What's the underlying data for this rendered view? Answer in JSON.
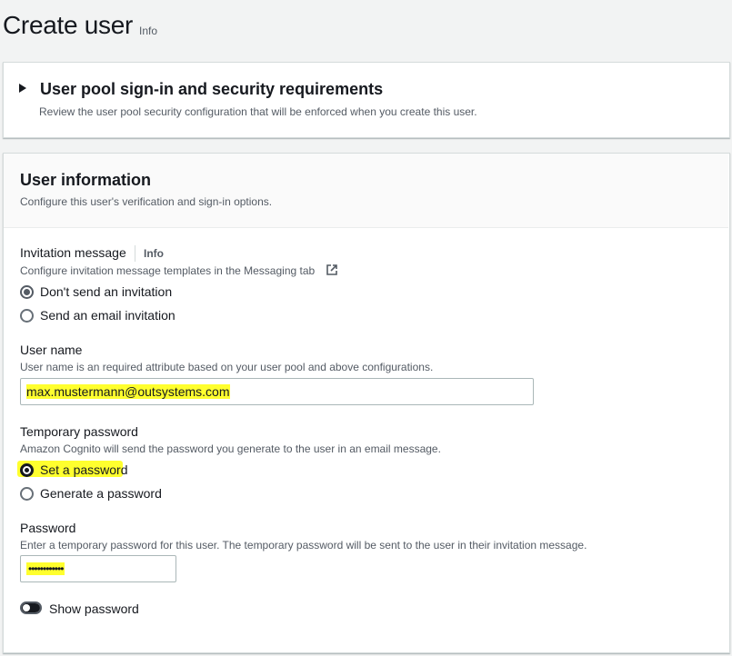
{
  "header": {
    "title": "Create user",
    "info": "Info"
  },
  "security_panel": {
    "title": "User pool sign-in and security requirements",
    "description": "Review the user pool security configuration that will be enforced when you create this user."
  },
  "user_info": {
    "title": "User information",
    "description": "Configure this user's verification and sign-in options.",
    "invitation": {
      "label": "Invitation message",
      "info": "Info",
      "description": "Configure invitation message templates in the Messaging tab",
      "options": [
        {
          "label": "Don't send an invitation",
          "selected": true
        },
        {
          "label": "Send an email invitation",
          "selected": false
        }
      ]
    },
    "username": {
      "label": "User name",
      "description": "User name is an required attribute based on your user pool and above configurations.",
      "value": "max.mustermann@outsystems.com"
    },
    "temp_password": {
      "label": "Temporary password",
      "description": "Amazon Cognito will send the password you generate to the user in an email message.",
      "options": [
        {
          "label": "Set a password",
          "selected": true
        },
        {
          "label": "Generate a password",
          "selected": false
        }
      ]
    },
    "password": {
      "label": "Password",
      "description": "Enter a temporary password for this user. The temporary password will be sent to the user in their invitation message.",
      "value": "••••••••••••"
    },
    "show_password": {
      "label": "Show password",
      "enabled": false
    }
  },
  "colors": {
    "highlight": "#ffff2e",
    "text": "#16191f",
    "muted": "#545b64"
  }
}
